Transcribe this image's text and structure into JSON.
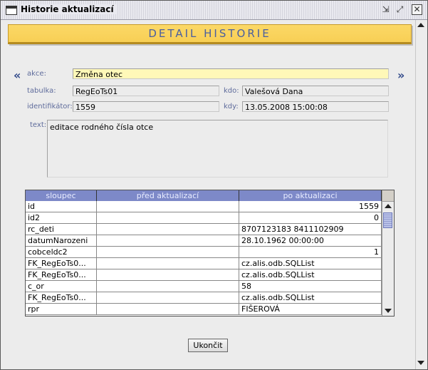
{
  "window": {
    "title": "Historie aktualizací",
    "buttons": {
      "minimize": "⇲",
      "maximize": "⤢",
      "close": "✕"
    }
  },
  "header": {
    "title": "DETAIL HISTORIE"
  },
  "nav": {
    "prev": "«",
    "next": "»"
  },
  "form": {
    "akce": {
      "label": "akce:",
      "value": "Změna otec"
    },
    "tabulka": {
      "label": "tabulka:",
      "value": "RegEoTs01"
    },
    "kdo": {
      "label": "kdo:",
      "value": "Valešová Dana"
    },
    "identifikator": {
      "label": "identifikátor:",
      "value": "1559"
    },
    "kdy": {
      "label": "kdy:",
      "value": "13.05.2008 15:00:08"
    },
    "text": {
      "label": "text:",
      "value": "editace rodného čísla otce"
    }
  },
  "table": {
    "columns": [
      "sloupec",
      "před aktualizací",
      "po aktualizaci"
    ],
    "rows": [
      [
        "id",
        "",
        "1559"
      ],
      [
        "id2",
        "",
        "0"
      ],
      [
        "rc_deti",
        "",
        "8707123183 8411102909"
      ],
      [
        "datumNarozeni",
        "",
        "28.10.1962 00:00:00"
      ],
      [
        "cobceldc2",
        "",
        "1"
      ],
      [
        "FK_RegEoTs0...",
        "",
        "cz.alis.odb.SQLList"
      ],
      [
        "FK_RegEoTs0...",
        "",
        "cz.alis.odb.SQLList"
      ],
      [
        "c_or",
        "",
        "58"
      ],
      [
        "FK_RegEoTs0...",
        "",
        "cz.alis.odb.SQLList"
      ],
      [
        "rpr",
        "",
        "FIŠEROVÁ"
      ]
    ]
  },
  "footer": {
    "close_button": "Ukončit"
  },
  "colors": {
    "header_band": "#f8cf55",
    "header_text": "#4a5fa0",
    "table_header": "#7d89c8",
    "active_field": "#fff8b8"
  }
}
